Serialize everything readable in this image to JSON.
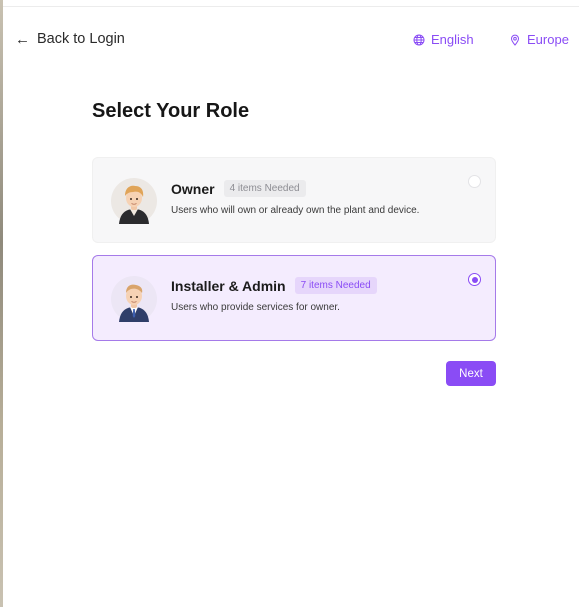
{
  "header": {
    "back_label": "Back to Login",
    "language": "English",
    "region": "Europe"
  },
  "page_title": "Select Your Role",
  "roles": [
    {
      "name": "Owner",
      "badge": "4 items Needed",
      "description": "Users who will own or already own the plant and device.",
      "selected": false
    },
    {
      "name": "Installer & Admin",
      "badge": "7 items Needed",
      "description": "Users who provide services for owner.",
      "selected": true
    }
  ],
  "next_label": "Next",
  "colors": {
    "accent": "#8a4cf5",
    "selected_card_bg": "#f4ecfe",
    "card_bg": "#f7f7f8"
  },
  "icons": {
    "back": "arrow-left-icon",
    "language": "globe-icon",
    "region": "location-pin-icon"
  }
}
